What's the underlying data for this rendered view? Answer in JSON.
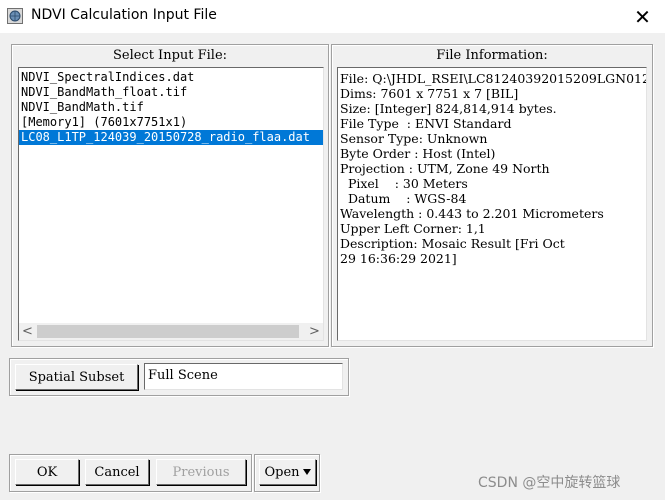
{
  "window": {
    "title": "NDVI Calculation Input File",
    "close_glyph": "✕",
    "icon": "app-globe-icon"
  },
  "select_input": {
    "label": "Select Input File:",
    "files": [
      "NDVI_SpectralIndices.dat",
      "NDVI_BandMath_float.tif",
      "NDVI_BandMath.tif",
      "[Memory1] (7601x7751x1)",
      "LC08_L1TP_124039_20150728_radio_flaa.dat"
    ],
    "selected_index": 4,
    "scroll_left": "<",
    "scroll_right": ">"
  },
  "file_info": {
    "label": "File Information:",
    "lines": [
      "File: Q:\\JHDL_RSEI\\LC81240392015209LGN012",
      "Dims: 7601 x 7751 x 7 [BIL]",
      "Size: [Integer] 824,814,914 bytes.",
      "File Type  : ENVI Standard",
      "Sensor Type: Unknown",
      "Byte Order : Host (Intel)",
      "Projection : UTM, Zone 49 North",
      "  Pixel    : 30 Meters",
      "  Datum    : WGS-84",
      "Wavelength : 0.443 to 2.201 Micrometers",
      "Upper Left Corner: 1,1",
      "Description: Mosaic Result [Fri Oct",
      "29 16:36:29 2021]"
    ]
  },
  "spatial_subset": {
    "button_label": "Spatial Subset",
    "value": "Full Scene"
  },
  "actions": {
    "ok": "OK",
    "cancel": "Cancel",
    "previous": "Previous",
    "open": "Open"
  },
  "watermark": "CSDN @空中旋转篮球",
  "colors": {
    "selection": "#0078d7",
    "background": "#f0f0f0"
  }
}
